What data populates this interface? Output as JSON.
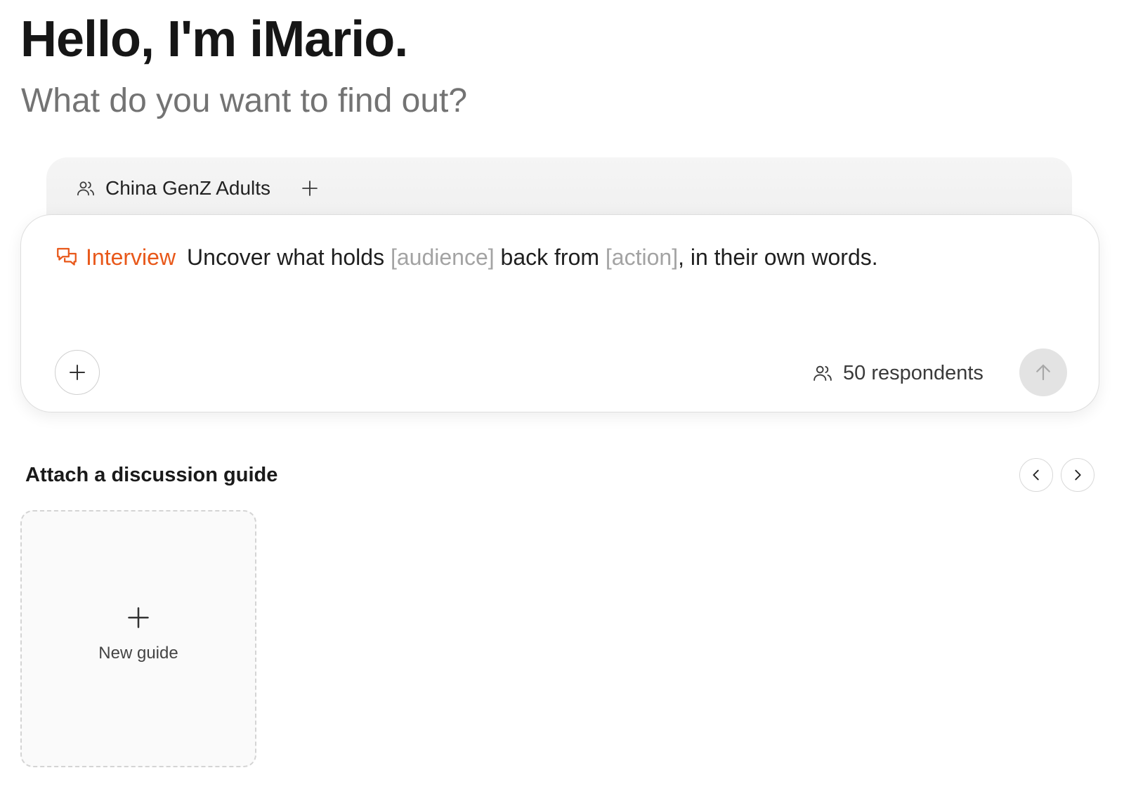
{
  "header": {
    "title": "Hello, I'm iMario.",
    "subtitle": "What do you want to find out?"
  },
  "audience": {
    "chip_icon": "users-icon",
    "chip_label": "China GenZ Adults",
    "add_icon": "plus-icon"
  },
  "composer": {
    "mode_icon": "chat-bubbles-icon",
    "mode_label": "Interview",
    "prompt_part1": "Uncover what holds",
    "placeholder1": "[audience]",
    "prompt_part2": "back from",
    "placeholder2": "[action]",
    "prompt_part3": ", in their own words.",
    "attach_icon": "plus-icon",
    "respondents_icon": "users-icon",
    "respondents_label": "50 respondents",
    "send_icon": "arrow-up-icon"
  },
  "guides": {
    "section_title": "Attach a discussion guide",
    "prev_icon": "chevron-left-icon",
    "next_icon": "chevron-right-icon",
    "new_guide_icon": "plus-icon",
    "new_guide_label": "New guide"
  },
  "colors": {
    "accent": "#e8581a",
    "placeholder": "#a3a3a3",
    "subtitle": "#737373",
    "send_button_bg": "#e3e3e3"
  }
}
